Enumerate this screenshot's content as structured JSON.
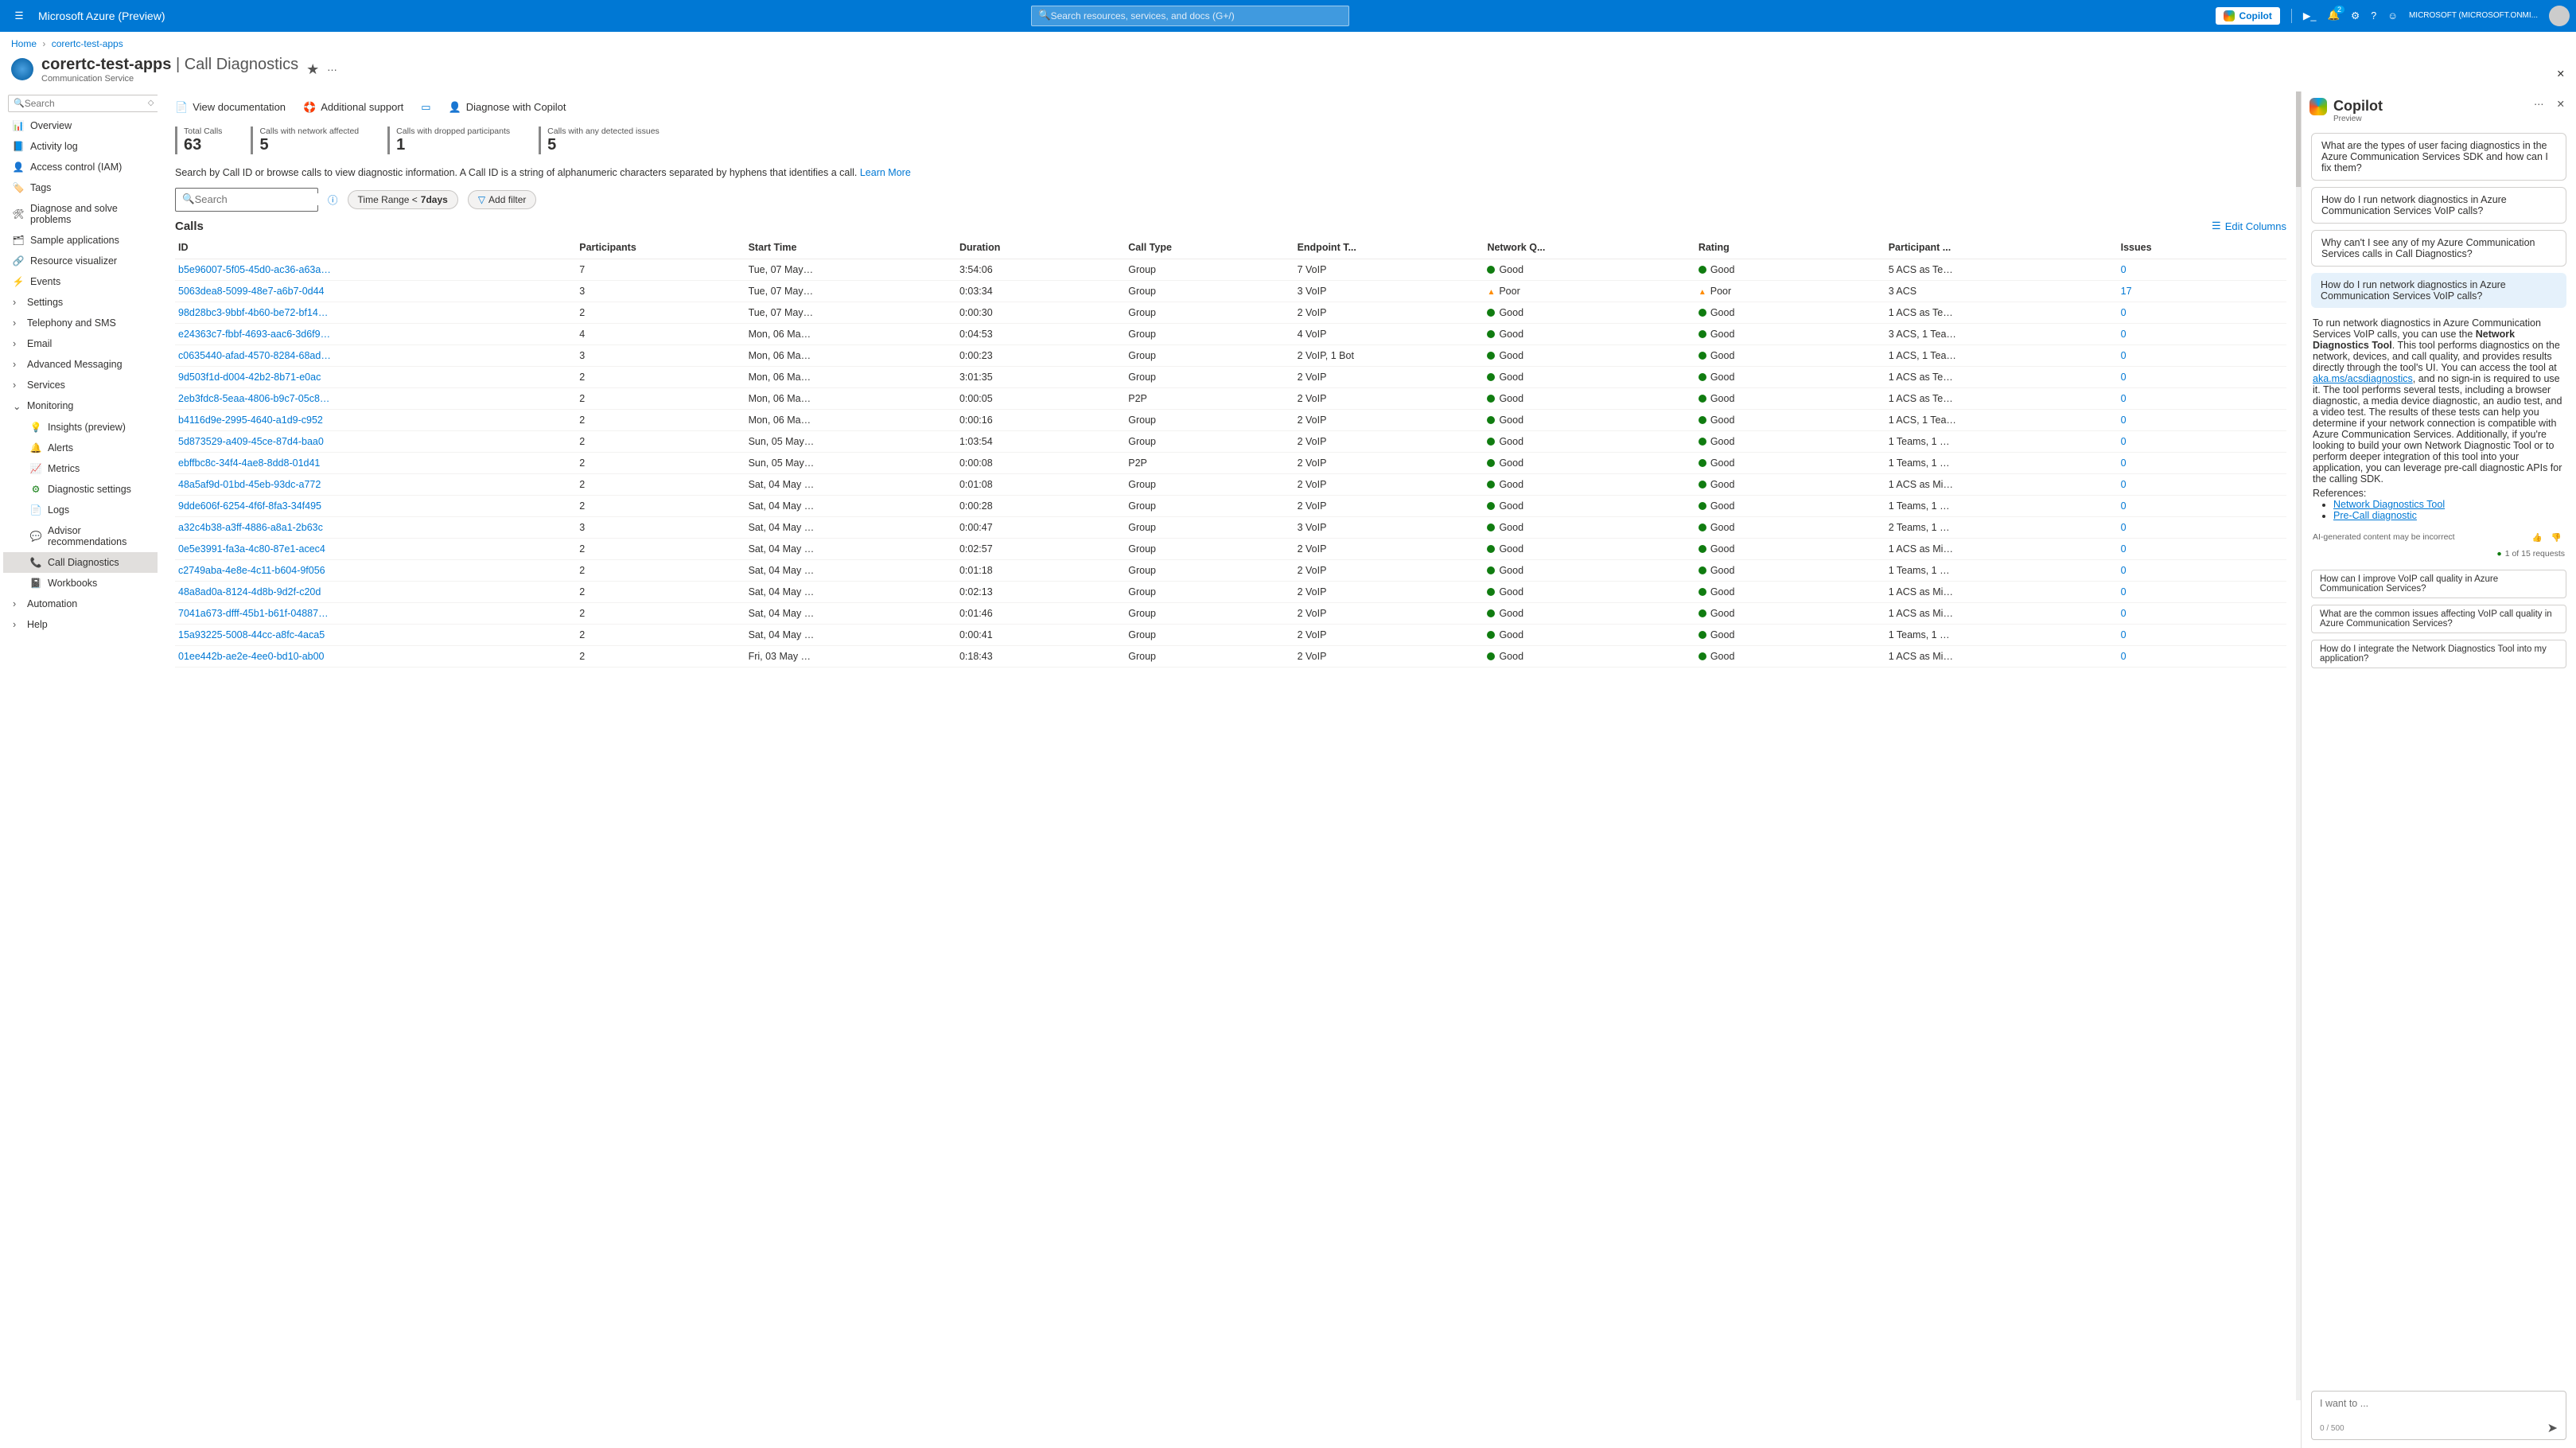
{
  "topbar": {
    "brand": "Microsoft Azure (Preview)",
    "search_placeholder": "Search resources, services, and docs (G+/)",
    "copilot_btn": "Copilot",
    "notif_badge": "2",
    "user_line": "MICROSOFT (MICROSOFT.ONMI..."
  },
  "breadcrumb": {
    "items": [
      "Home",
      "corertc-test-apps"
    ]
  },
  "page": {
    "resource_name": "corertc-test-apps",
    "blade_name": "Call Diagnostics",
    "resource_type": "Communication Service"
  },
  "actions": {
    "view_doc": "View documentation",
    "addl_support": "Additional support",
    "diag_copilot": "Diagnose with Copilot"
  },
  "stats": [
    {
      "label": "Total Calls",
      "value": "63"
    },
    {
      "label": "Calls with network affected",
      "value": "5"
    },
    {
      "label": "Calls with dropped participants",
      "value": "1"
    },
    {
      "label": "Calls with any detected issues",
      "value": "5"
    }
  ],
  "hint_text": "Search by Call ID or browse calls to view diagnostic information. A Call ID is a string of alphanumeric characters separated by hyphens that identifies a call. ",
  "hint_link": "Learn More",
  "search_placeholder": "Search",
  "time_chip_prefix": "Time Range < ",
  "time_chip_value": "7days",
  "filter_chip": "Add filter",
  "calls_heading": "Calls",
  "edit_columns": "Edit Columns",
  "columns": [
    "ID",
    "Participants",
    "Start Time",
    "Duration",
    "Call Type",
    "Endpoint T...",
    "Network Q...",
    "Rating",
    "Participant ...",
    "Issues"
  ],
  "rows": [
    {
      "id": "b5e96007-5f05-45d0-ac36-a63a…",
      "p": "7",
      "start": "Tue, 07 May…",
      "dur": "3:54:06",
      "type": "Group",
      "ep": "7 VoIP",
      "nq": "Good",
      "rating": "Good",
      "pi": "5 ACS as Te…",
      "iss": "0",
      "nqc": "good",
      "rc": "good"
    },
    {
      "id": "5063dea8-5099-48e7-a6b7-0d44",
      "p": "3",
      "start": "Tue, 07 May…",
      "dur": "0:03:34",
      "type": "Group",
      "ep": "3 VoIP",
      "nq": "Poor",
      "rating": "Poor",
      "pi": "3 ACS",
      "iss": "17",
      "nqc": "poor",
      "rc": "poor"
    },
    {
      "id": "98d28bc3-9bbf-4b60-be72-bf14…",
      "p": "2",
      "start": "Tue, 07 May…",
      "dur": "0:00:30",
      "type": "Group",
      "ep": "2 VoIP",
      "nq": "Good",
      "rating": "Good",
      "pi": "1 ACS as Te…",
      "iss": "0",
      "nqc": "good",
      "rc": "good"
    },
    {
      "id": "e24363c7-fbbf-4693-aac6-3d6f9…",
      "p": "4",
      "start": "Mon, 06 Ma…",
      "dur": "0:04:53",
      "type": "Group",
      "ep": "4 VoIP",
      "nq": "Good",
      "rating": "Good",
      "pi": "3 ACS, 1 Tea…",
      "iss": "0",
      "nqc": "good",
      "rc": "good"
    },
    {
      "id": "c0635440-afad-4570-8284-68ad…",
      "p": "3",
      "start": "Mon, 06 Ma…",
      "dur": "0:00:23",
      "type": "Group",
      "ep": "2 VoIP, 1 Bot",
      "nq": "Good",
      "rating": "Good",
      "pi": "1 ACS, 1 Tea…",
      "iss": "0",
      "nqc": "good",
      "rc": "good"
    },
    {
      "id": "9d503f1d-d004-42b2-8b71-e0ac",
      "p": "2",
      "start": "Mon, 06 Ma…",
      "dur": "3:01:35",
      "type": "Group",
      "ep": "2 VoIP",
      "nq": "Good",
      "rating": "Good",
      "pi": "1 ACS as Te…",
      "iss": "0",
      "nqc": "good",
      "rc": "good"
    },
    {
      "id": "2eb3fdc8-5eaa-4806-b9c7-05c8…",
      "p": "2",
      "start": "Mon, 06 Ma…",
      "dur": "0:00:05",
      "type": "P2P",
      "ep": "2 VoIP",
      "nq": "Good",
      "rating": "Good",
      "pi": "1 ACS as Te…",
      "iss": "0",
      "nqc": "good",
      "rc": "good"
    },
    {
      "id": "b4116d9e-2995-4640-a1d9-c952",
      "p": "2",
      "start": "Mon, 06 Ma…",
      "dur": "0:00:16",
      "type": "Group",
      "ep": "2 VoIP",
      "nq": "Good",
      "rating": "Good",
      "pi": "1 ACS, 1 Tea…",
      "iss": "0",
      "nqc": "good",
      "rc": "good"
    },
    {
      "id": "5d873529-a409-45ce-87d4-baa0",
      "p": "2",
      "start": "Sun, 05 May…",
      "dur": "1:03:54",
      "type": "Group",
      "ep": "2 VoIP",
      "nq": "Good",
      "rating": "Good",
      "pi": "1 Teams, 1 …",
      "iss": "0",
      "nqc": "good",
      "rc": "good"
    },
    {
      "id": "ebffbc8c-34f4-4ae8-8dd8-01d41",
      "p": "2",
      "start": "Sun, 05 May…",
      "dur": "0:00:08",
      "type": "P2P",
      "ep": "2 VoIP",
      "nq": "Good",
      "rating": "Good",
      "pi": "1 Teams, 1 …",
      "iss": "0",
      "nqc": "good",
      "rc": "good"
    },
    {
      "id": "48a5af9d-01bd-45eb-93dc-a772",
      "p": "2",
      "start": "Sat, 04 May …",
      "dur": "0:01:08",
      "type": "Group",
      "ep": "2 VoIP",
      "nq": "Good",
      "rating": "Good",
      "pi": "1 ACS as Mi…",
      "iss": "0",
      "nqc": "good",
      "rc": "good"
    },
    {
      "id": "9dde606f-6254-4f6f-8fa3-34f495",
      "p": "2",
      "start": "Sat, 04 May …",
      "dur": "0:00:28",
      "type": "Group",
      "ep": "2 VoIP",
      "nq": "Good",
      "rating": "Good",
      "pi": "1 Teams, 1 …",
      "iss": "0",
      "nqc": "good",
      "rc": "good"
    },
    {
      "id": "a32c4b38-a3ff-4886-a8a1-2b63c",
      "p": "3",
      "start": "Sat, 04 May …",
      "dur": "0:00:47",
      "type": "Group",
      "ep": "3 VoIP",
      "nq": "Good",
      "rating": "Good",
      "pi": "2 Teams, 1 …",
      "iss": "0",
      "nqc": "good",
      "rc": "good"
    },
    {
      "id": "0e5e3991-fa3a-4c80-87e1-acec4",
      "p": "2",
      "start": "Sat, 04 May …",
      "dur": "0:02:57",
      "type": "Group",
      "ep": "2 VoIP",
      "nq": "Good",
      "rating": "Good",
      "pi": "1 ACS as Mi…",
      "iss": "0",
      "nqc": "good",
      "rc": "good"
    },
    {
      "id": "c2749aba-4e8e-4c11-b604-9f056",
      "p": "2",
      "start": "Sat, 04 May …",
      "dur": "0:01:18",
      "type": "Group",
      "ep": "2 VoIP",
      "nq": "Good",
      "rating": "Good",
      "pi": "1 Teams, 1 …",
      "iss": "0",
      "nqc": "good",
      "rc": "good"
    },
    {
      "id": "48a8ad0a-8124-4d8b-9d2f-c20d",
      "p": "2",
      "start": "Sat, 04 May …",
      "dur": "0:02:13",
      "type": "Group",
      "ep": "2 VoIP",
      "nq": "Good",
      "rating": "Good",
      "pi": "1 ACS as Mi…",
      "iss": "0",
      "nqc": "good",
      "rc": "good"
    },
    {
      "id": "7041a673-dfff-45b1-b61f-04887…",
      "p": "2",
      "start": "Sat, 04 May …",
      "dur": "0:01:46",
      "type": "Group",
      "ep": "2 VoIP",
      "nq": "Good",
      "rating": "Good",
      "pi": "1 ACS as Mi…",
      "iss": "0",
      "nqc": "good",
      "rc": "good"
    },
    {
      "id": "15a93225-5008-44cc-a8fc-4aca5",
      "p": "2",
      "start": "Sat, 04 May …",
      "dur": "0:00:41",
      "type": "Group",
      "ep": "2 VoIP",
      "nq": "Good",
      "rating": "Good",
      "pi": "1 Teams, 1 …",
      "iss": "0",
      "nqc": "good",
      "rc": "good"
    },
    {
      "id": "01ee442b-ae2e-4ee0-bd10-ab00",
      "p": "2",
      "start": "Fri, 03 May …",
      "dur": "0:18:43",
      "type": "Group",
      "ep": "2 VoIP",
      "nq": "Good",
      "rating": "Good",
      "pi": "1 ACS as Mi…",
      "iss": "0",
      "nqc": "good",
      "rc": "good"
    }
  ],
  "sidebar": {
    "search_placeholder": "Search",
    "items": [
      {
        "icon": "📊",
        "label": "Overview",
        "chev": ""
      },
      {
        "icon": "📘",
        "label": "Activity log",
        "chev": ""
      },
      {
        "icon": "👤",
        "label": "Access control (IAM)",
        "chev": ""
      },
      {
        "icon": "🏷️",
        "label": "Tags",
        "chev": "",
        "color": "#8661c5"
      },
      {
        "icon": "🛠",
        "label": "Diagnose and solve problems",
        "chev": ""
      },
      {
        "icon": "🗂",
        "label": "Sample applications",
        "chev": ""
      },
      {
        "icon": "🔗",
        "label": "Resource visualizer",
        "chev": ""
      },
      {
        "icon": "⚡",
        "label": "Events",
        "chev": "",
        "color": "#ffb900"
      },
      {
        "icon": "",
        "label": "Settings",
        "chev": "›"
      },
      {
        "icon": "",
        "label": "Telephony and SMS",
        "chev": "›"
      },
      {
        "icon": "",
        "label": "Email",
        "chev": "›"
      },
      {
        "icon": "",
        "label": "Advanced Messaging",
        "chev": "›"
      },
      {
        "icon": "",
        "label": "Services",
        "chev": "›"
      },
      {
        "icon": "",
        "label": "Monitoring",
        "chev": "⌄",
        "expanded": true
      },
      {
        "icon": "💡",
        "label": "Insights (preview)",
        "chev": "",
        "indent": true,
        "color": "#8661c5"
      },
      {
        "icon": "🔔",
        "label": "Alerts",
        "chev": "",
        "indent": true
      },
      {
        "icon": "📈",
        "label": "Metrics",
        "chev": "",
        "indent": true
      },
      {
        "icon": "⚙",
        "label": "Diagnostic settings",
        "chev": "",
        "indent": true,
        "color": "#107c10"
      },
      {
        "icon": "📄",
        "label": "Logs",
        "chev": "",
        "indent": true,
        "color": "#0078d4"
      },
      {
        "icon": "💬",
        "label": "Advisor recommendations",
        "chev": "",
        "indent": true,
        "color": "#0078d4"
      },
      {
        "icon": "📞",
        "label": "Call Diagnostics",
        "chev": "",
        "indent": true,
        "selected": true,
        "color": "#0078d4"
      },
      {
        "icon": "📓",
        "label": "Workbooks",
        "chev": "",
        "indent": true,
        "color": "#8661c5"
      },
      {
        "icon": "",
        "label": "Automation",
        "chev": "›"
      },
      {
        "icon": "",
        "label": "Help",
        "chev": "›"
      }
    ]
  },
  "copilot": {
    "title": "Copilot",
    "preview": "Preview",
    "suggestion_cards": [
      "What are the types of user facing diagnostics in the Azure Communication Services SDK and how can I fix them?",
      "How do I run network diagnostics in Azure Communication Services VoIP calls?",
      "Why can't I see any of my Azure Communication Services calls in Call Diagnostics?"
    ],
    "user_msg": "How do I run network diagnostics in Azure Communication Services VoIP calls?",
    "bot_pre": "To run network diagnostics in Azure Communication Services VoIP calls, you can use the ",
    "bot_bold": "Network Diagnostics Tool",
    "bot_post1": ". This tool performs diagnostics on the network, devices, and call quality, and provides results directly through the tool's UI. You can access the tool at ",
    "bot_link": "aka.ms/acsdiagnostics",
    "bot_post2": ", and no sign-in is required to use it. The tool performs several tests, including a browser diagnostic, a media device diagnostic, an audio test, and a video test. The results of these tests can help you determine if your network connection is compatible with Azure Communication Services. Additionally, if you're looking to build your own Network Diagnostic Tool or to perform deeper integration of this tool into your application, you can leverage pre-call diagnostic APIs for the calling SDK.",
    "references_label": "References:",
    "references": [
      "Network Diagnostics Tool",
      "Pre-Call diagnostic"
    ],
    "ai_disclaimer": "AI-generated content may be incorrect",
    "requests": "1 of 15 requests",
    "followups": [
      "How can I improve VoIP call quality in Azure Communication Services?",
      "What are the common issues affecting VoIP call quality in Azure Communication Services?",
      "How do I integrate the Network Diagnostics Tool into my application?"
    ],
    "input_placeholder": "I want to ...",
    "char_count": "0 / 500"
  }
}
